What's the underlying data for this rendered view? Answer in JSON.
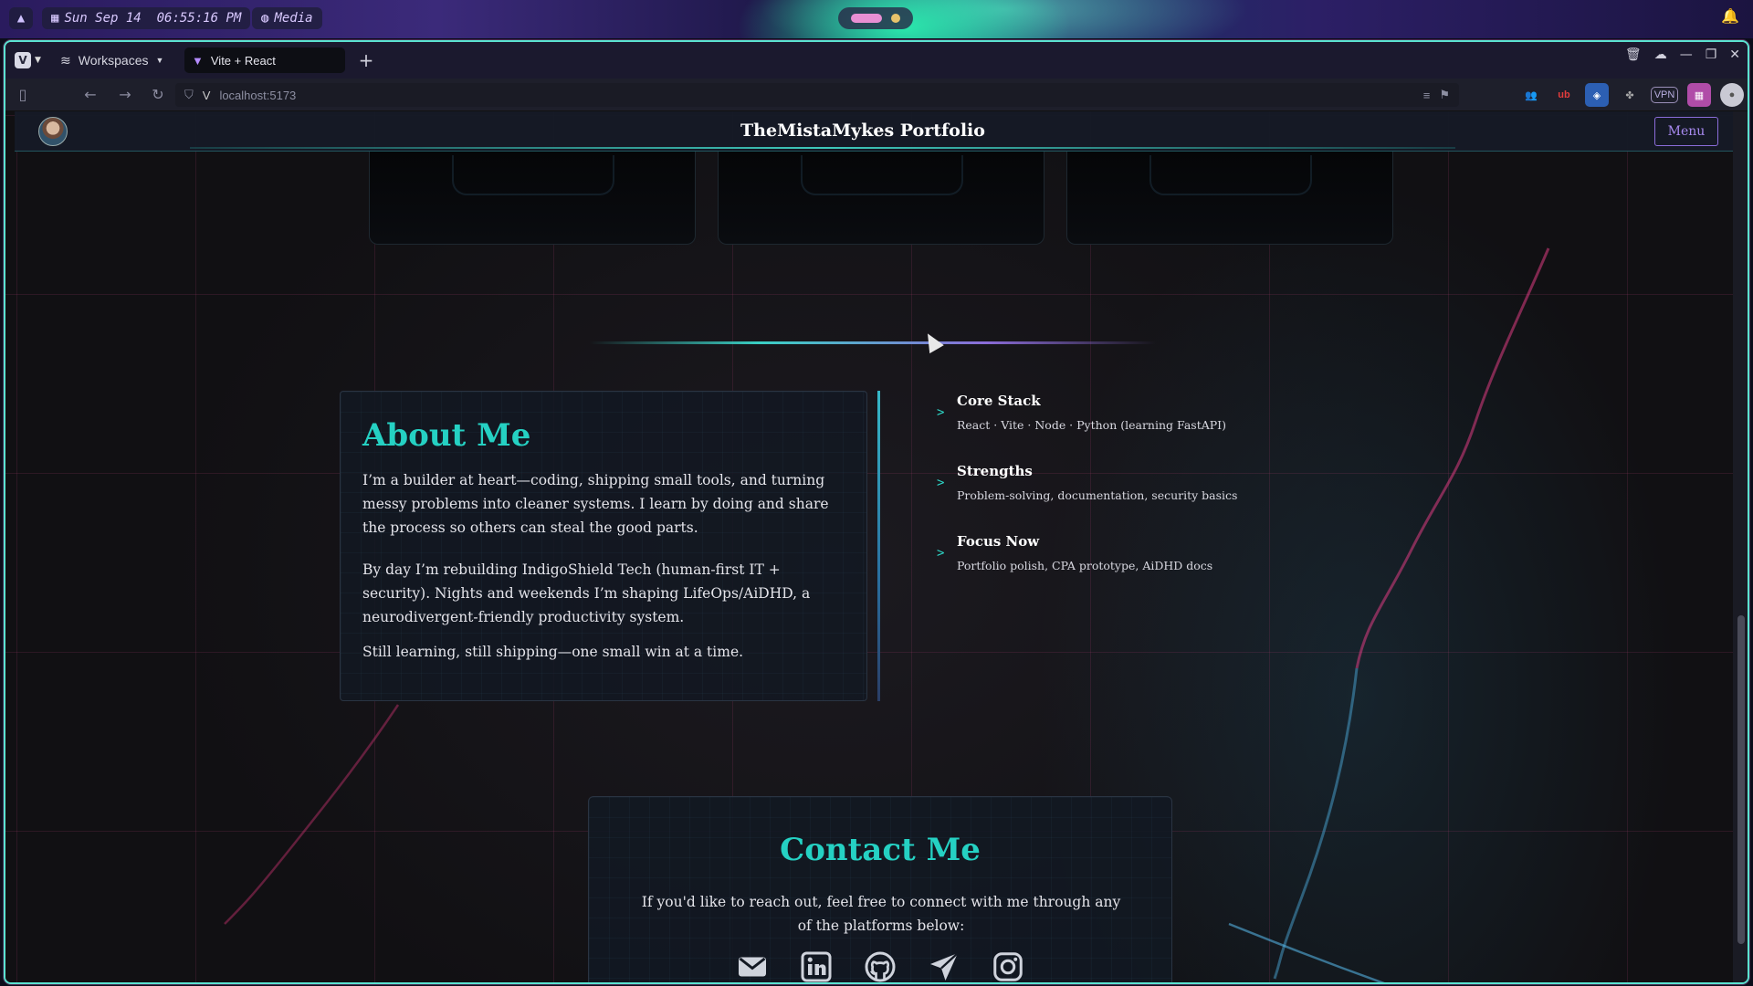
{
  "desktop_bar": {
    "datetime": "Sun Sep 14  06:55:16 PM",
    "media_label": "Media"
  },
  "browser": {
    "workspaces_label": "Workspaces",
    "active_tab_title": "Vite + React",
    "url": "localhost:5173",
    "extensions": [
      "ub",
      "VPN"
    ]
  },
  "site": {
    "title": "TheMistaMykes Portfolio",
    "menu_label": "Menu",
    "about": {
      "heading": "About Me",
      "paragraphs": [
        "I’m a builder at heart—coding, shipping small tools, and turning messy problems into cleaner systems. I learn by doing and share the process so others can steal the good parts.",
        "By day I’m rebuilding IndigoShield Tech (human-first IT + security). Nights and weekends I’m shaping LifeOps/AiDHD, a neurodivergent-friendly productivity system.",
        "Still learning, still shipping—one small win at a time."
      ]
    },
    "info": [
      {
        "title": "Core Stack",
        "desc": "React · Vite · Node · Python (learning FastAPI)"
      },
      {
        "title": "Strengths",
        "desc": "Problem-solving, documentation, security basics"
      },
      {
        "title": "Focus Now",
        "desc": "Portfolio polish, CPA prototype, AiDHD docs"
      }
    ],
    "info_arrow": ">",
    "contact": {
      "heading": "Contact Me",
      "text": "If you'd like to reach out, feel free to connect with me through any of the platforms below:",
      "icons": [
        "mail-icon",
        "linkedin-icon",
        "github-icon",
        "telegram-icon",
        "instagram-icon"
      ]
    }
  },
  "colors": {
    "accent_teal": "#25d1c3",
    "accent_purple": "#8b6cd9",
    "card_bg": "#121822"
  }
}
